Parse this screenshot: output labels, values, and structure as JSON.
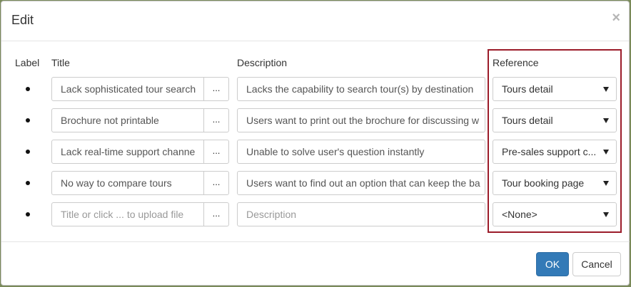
{
  "dialog": {
    "title": "Edit",
    "close_glyph": "×"
  },
  "columns": {
    "label": "Label",
    "title": "Title",
    "description": "Description",
    "reference": "Reference"
  },
  "rows": [
    {
      "title": "Lack sophisticated tour search",
      "description": "Lacks the capability to search tour(s) by destination",
      "reference": "Tours detail"
    },
    {
      "title": "Brochure not printable",
      "description": "Users want to print out the brochure for discussing w",
      "reference": "Tours detail"
    },
    {
      "title": "Lack real-time support channe",
      "description": "Unable to solve user's question instantly",
      "reference": "Pre-sales support c..."
    },
    {
      "title": "No way to compare tours",
      "description": "Users want to find out an option that can keep the ba",
      "reference": "Tour booking page"
    },
    {
      "title_placeholder": "Title or click ... to upload file",
      "description_placeholder": "Description",
      "reference": "<None>"
    }
  ],
  "dots_label": "...",
  "footer": {
    "ok_label": "OK",
    "cancel_label": "Cancel"
  },
  "colors": {
    "highlight_border": "#9b1c2a",
    "primary_button": "#337ab7"
  }
}
